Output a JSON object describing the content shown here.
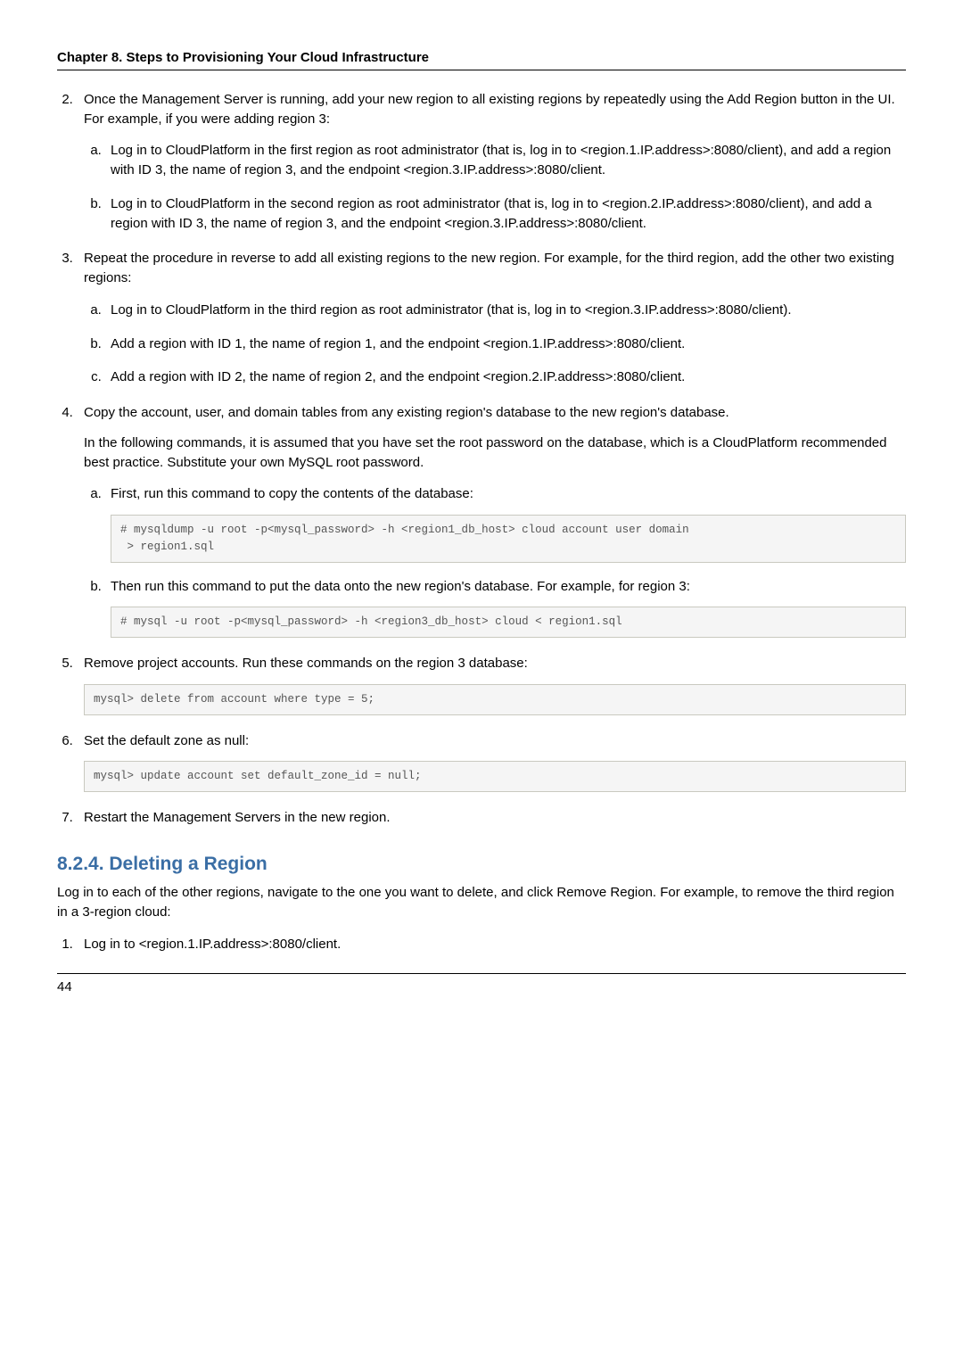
{
  "header": {
    "chapter": "Chapter 8. Steps to Provisioning Your Cloud Infrastructure"
  },
  "list": {
    "item2": {
      "text": "Once the Management Server is running, add your new region to all existing regions by repeatedly using the Add Region button in the UI. For example, if you were adding region 3:",
      "a": "Log in to CloudPlatform in the first region as root administrator (that is, log in to <region.1.IP.address>:8080/client), and add a region with ID 3, the name of region 3, and the endpoint <region.3.IP.address>:8080/client.",
      "b": "Log in to CloudPlatform in the second region as root administrator (that is, log in to <region.2.IP.address>:8080/client), and add a region with ID 3, the name of region 3, and the endpoint <region.3.IP.address>:8080/client."
    },
    "item3": {
      "text": "Repeat the procedure in reverse to add all existing regions to the new region. For example, for the third region, add the other two existing regions:",
      "a": "Log in to CloudPlatform in the third region as root administrator (that is, log in to <region.3.IP.address>:8080/client).",
      "b": "Add a region with ID 1, the name of region 1, and the endpoint <region.1.IP.address>:8080/client.",
      "c": "Add a region with ID 2, the name of region 2, and the endpoint <region.2.IP.address>:8080/client."
    },
    "item4": {
      "text": "Copy the account, user, and domain tables from any existing region's database to the new region's database.",
      "para": "In the following commands, it is assumed that you have set the root password on the database, which is a CloudPlatform recommended best practice. Substitute your own MySQL root password.",
      "a": "First, run this command to copy the contents of the database:",
      "code_a": "# mysqldump -u root -p<mysql_password> -h <region1_db_host> cloud account user domain\n > region1.sql",
      "b": "Then run this command to put the data onto the new region's database. For example, for region 3:",
      "code_b": "# mysql -u root -p<mysql_password> -h <region3_db_host> cloud < region1.sql"
    },
    "item5": {
      "text": "Remove project accounts. Run these commands on the region 3 database:",
      "code": "mysql> delete from account where type = 5;"
    },
    "item6": {
      "text": "Set the default zone as null:",
      "code": "mysql> update account set default_zone_id = null;"
    },
    "item7": {
      "text": "Restart the Management Servers in the new region."
    }
  },
  "section": {
    "number_title": "8.2.4. Deleting a Region",
    "intro": "Log in to each of the other regions, navigate to the one you want to delete, and click Remove Region. For example, to remove the third region in a 3-region cloud:",
    "step1": "Log in to <region.1.IP.address>:8080/client."
  },
  "footer": {
    "page": "44"
  }
}
